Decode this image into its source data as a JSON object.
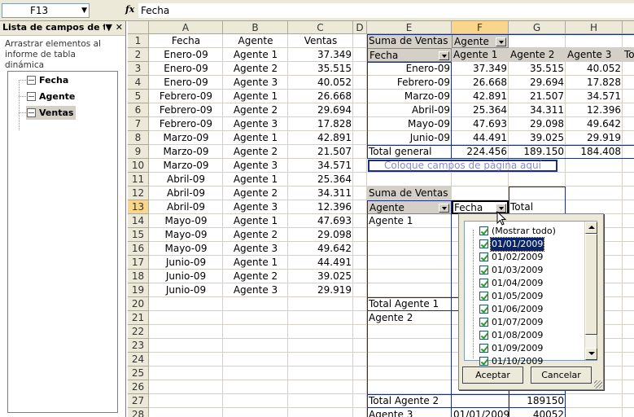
{
  "formula_bar": {
    "cell_ref": "F13",
    "fx": "fx",
    "value": "Fecha"
  },
  "field_pane": {
    "title": "Lista de campos de t",
    "instructions": "Arrastrar elementos al informe de tabla dinámica",
    "fields": [
      "Fecha",
      "Agente",
      "Ventas"
    ]
  },
  "columns": [
    "A",
    "B",
    "C",
    "D",
    "E",
    "F",
    "G",
    "H"
  ],
  "rows": [
    "1",
    "2",
    "3",
    "4",
    "5",
    "6",
    "7",
    "8",
    "9",
    "10",
    "11",
    "12",
    "13",
    "14",
    "15",
    "16",
    "17",
    "18",
    "19",
    "20",
    "21",
    "22",
    "23",
    "24",
    "25",
    "26",
    "27",
    "28"
  ],
  "data_headers": [
    "Fecha",
    "Agente",
    "Ventas"
  ],
  "data_rows": [
    [
      "Enero-09",
      "Agente 1",
      "37.349"
    ],
    [
      "Enero-09",
      "Agente 2",
      "35.515"
    ],
    [
      "Enero-09",
      "Agente 3",
      "40.052"
    ],
    [
      "Febrero-09",
      "Agente 1",
      "26.668"
    ],
    [
      "Febrero-09",
      "Agente 2",
      "29.694"
    ],
    [
      "Febrero-09",
      "Agente 3",
      "17.828"
    ],
    [
      "Marzo-09",
      "Agente 1",
      "42.891"
    ],
    [
      "Marzo-09",
      "Agente 2",
      "21.507"
    ],
    [
      "Marzo-09",
      "Agente 3",
      "34.571"
    ],
    [
      "Abril-09",
      "Agente 1",
      "25.364"
    ],
    [
      "Abril-09",
      "Agente 2",
      "34.311"
    ],
    [
      "Abril-09",
      "Agente 3",
      "12.396"
    ],
    [
      "Mayo-09",
      "Agente 1",
      "47.693"
    ],
    [
      "Mayo-09",
      "Agente 2",
      "29.098"
    ],
    [
      "Mayo-09",
      "Agente 3",
      "49.642"
    ],
    [
      "Junio-09",
      "Agente 1",
      "44.491"
    ],
    [
      "Junio-09",
      "Agente 2",
      "39.025"
    ],
    [
      "Junio-09",
      "Agente 3",
      "29.919"
    ]
  ],
  "pivot1": {
    "title": "Suma de Ventas",
    "col_field": "Agente",
    "row_field": "Fecha",
    "col_headers": [
      "Agente 1",
      "Agente 2",
      "Agente 3",
      "Tota"
    ],
    "rows": [
      [
        "Enero-09",
        "37.349",
        "35.515",
        "40.052"
      ],
      [
        "Febrero-09",
        "26.668",
        "29.694",
        "17.828"
      ],
      [
        "Marzo-09",
        "42.891",
        "21.507",
        "34.571"
      ],
      [
        "Abril-09",
        "25.364",
        "34.311",
        "12.396"
      ],
      [
        "Mayo-09",
        "47.693",
        "29.098",
        "49.642"
      ],
      [
        "Junio-09",
        "44.491",
        "39.025",
        "29.919"
      ]
    ],
    "total_label": "Total general",
    "totals": [
      "224.456",
      "189.150",
      "184.408"
    ],
    "page_zone": "Coloque campos de página aquí"
  },
  "pivot2": {
    "title": "Suma de Ventas",
    "row_field": "Agente",
    "col_field": "Fecha",
    "total_header": "Total",
    "agent1": "Agente 1",
    "total_agent1": "Total Agente 1",
    "agent2": "Agente 2",
    "total_agent2": "Total Agente 2",
    "total_agent2_value": "189150",
    "agent3": "Agente 3",
    "agent3_date": "01/01/2009",
    "agent3_value": "40052"
  },
  "filter_popup": {
    "items": [
      "(Mostrar todo)",
      "01/01/2009",
      "01/02/2009",
      "01/03/2009",
      "01/04/2009",
      "01/05/2009",
      "01/06/2009",
      "01/07/2009",
      "01/08/2009",
      "01/09/2009",
      "01/10/2009"
    ],
    "accept": "Aceptar",
    "cancel": "Cancelar"
  },
  "colors": {
    "header_bg": "#ece9d8",
    "active_header": "#f9d68b",
    "pivot_border": "#1c2f7f",
    "selection": "#0a246a"
  }
}
